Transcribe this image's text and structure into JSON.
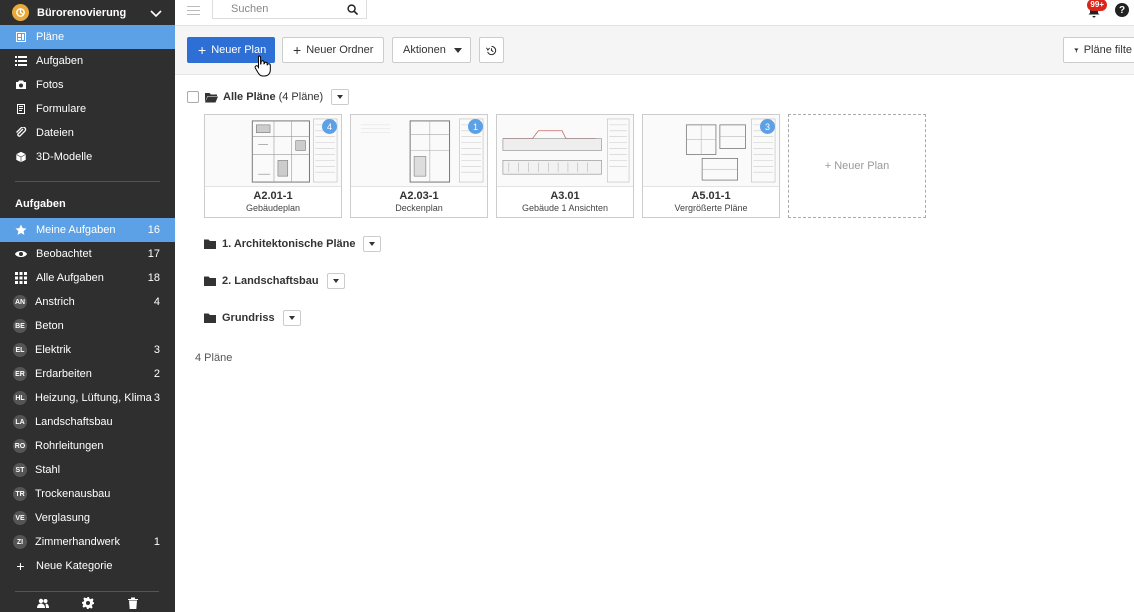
{
  "project": {
    "name": "Bürorenovierung"
  },
  "nav": [
    {
      "label": "Pläne",
      "icon": "plans-icon",
      "active": true
    },
    {
      "label": "Aufgaben",
      "icon": "list-icon"
    },
    {
      "label": "Fotos",
      "icon": "camera-icon"
    },
    {
      "label": "Formulare",
      "icon": "form-icon"
    },
    {
      "label": "Dateien",
      "icon": "paperclip-icon"
    },
    {
      "label": "3D-Modelle",
      "icon": "cube-icon"
    }
  ],
  "tasks_section": {
    "title": "Aufgaben",
    "items": [
      {
        "label": "Meine Aufgaben",
        "count": "16",
        "icon": "star-icon",
        "active": true
      },
      {
        "label": "Beobachtet",
        "count": "17",
        "icon": "eye-icon"
      },
      {
        "label": "Alle Aufgaben",
        "count": "18",
        "icon": "grid-icon"
      },
      {
        "label": "Anstrich",
        "count": "4",
        "abbr": "AN"
      },
      {
        "label": "Beton",
        "count": "",
        "abbr": "BE"
      },
      {
        "label": "Elektrik",
        "count": "3",
        "abbr": "EL"
      },
      {
        "label": "Erdarbeiten",
        "count": "2",
        "abbr": "ER"
      },
      {
        "label": "Heizung, Lüftung, Klima",
        "count": "3",
        "abbr": "HL"
      },
      {
        "label": "Landschaftsbau",
        "count": "",
        "abbr": "LA"
      },
      {
        "label": "Rohrleitungen",
        "count": "",
        "abbr": "RO"
      },
      {
        "label": "Stahl",
        "count": "",
        "abbr": "ST"
      },
      {
        "label": "Trockenausbau",
        "count": "",
        "abbr": "TR"
      },
      {
        "label": "Verglasung",
        "count": "",
        "abbr": "VE"
      },
      {
        "label": "Zimmerhandwerk",
        "count": "1",
        "abbr": "ZI"
      }
    ],
    "new_category": "Neue Kategorie"
  },
  "topbar": {
    "search_placeholder": "Suchen",
    "notification_badge": "99+",
    "help": "?"
  },
  "toolbar": {
    "new_plan": "Neuer Plan",
    "new_folder": "Neuer Ordner",
    "actions": "Aktionen",
    "filter": "Pläne filte"
  },
  "all_plans": {
    "title": "Alle Pläne",
    "count": "(4 Pläne)"
  },
  "plans": [
    {
      "code": "A2.01-1",
      "desc": "Gebäudeplan",
      "pins": "4"
    },
    {
      "code": "A2.03-1",
      "desc": "Deckenplan",
      "pins": "1"
    },
    {
      "code": "A3.01",
      "desc": "Gebäude 1 Ansichten",
      "pins": ""
    },
    {
      "code": "A5.01-1",
      "desc": "Vergrößerte Pläne",
      "pins": "3"
    }
  ],
  "new_plan_card": "+ Neuer Plan",
  "folders": [
    {
      "title": "1. Architektonische Pläne"
    },
    {
      "title": "2. Landschaftsbau"
    },
    {
      "title": "Grundriss"
    }
  ],
  "footer_count": "4 Pläne",
  "colors": {
    "accent": "#2d6fd5",
    "sidebar_active": "#5ca0e6",
    "sidebar_bg": "#2f2f2f",
    "badge": "#d9261c"
  }
}
